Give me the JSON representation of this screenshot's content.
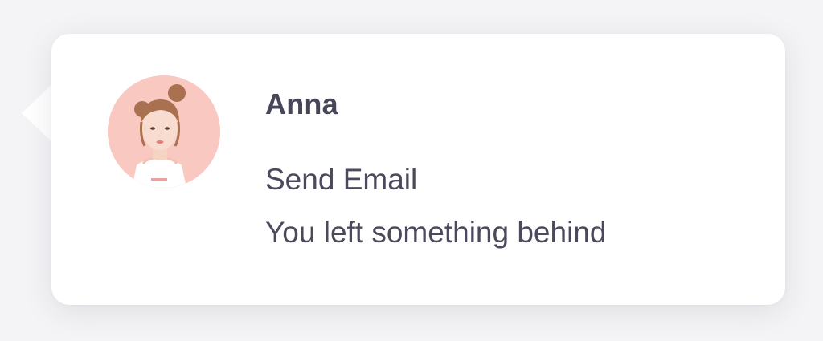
{
  "notification": {
    "sender": "Anna",
    "subject": "Send Email",
    "message": "You left something behind",
    "avatar_icon": "avatar-photo-icon"
  },
  "colors": {
    "card_background": "#ffffff",
    "page_background": "#f4f4f6",
    "text_primary": "#464658",
    "avatar_background": "#f8c8c1"
  }
}
